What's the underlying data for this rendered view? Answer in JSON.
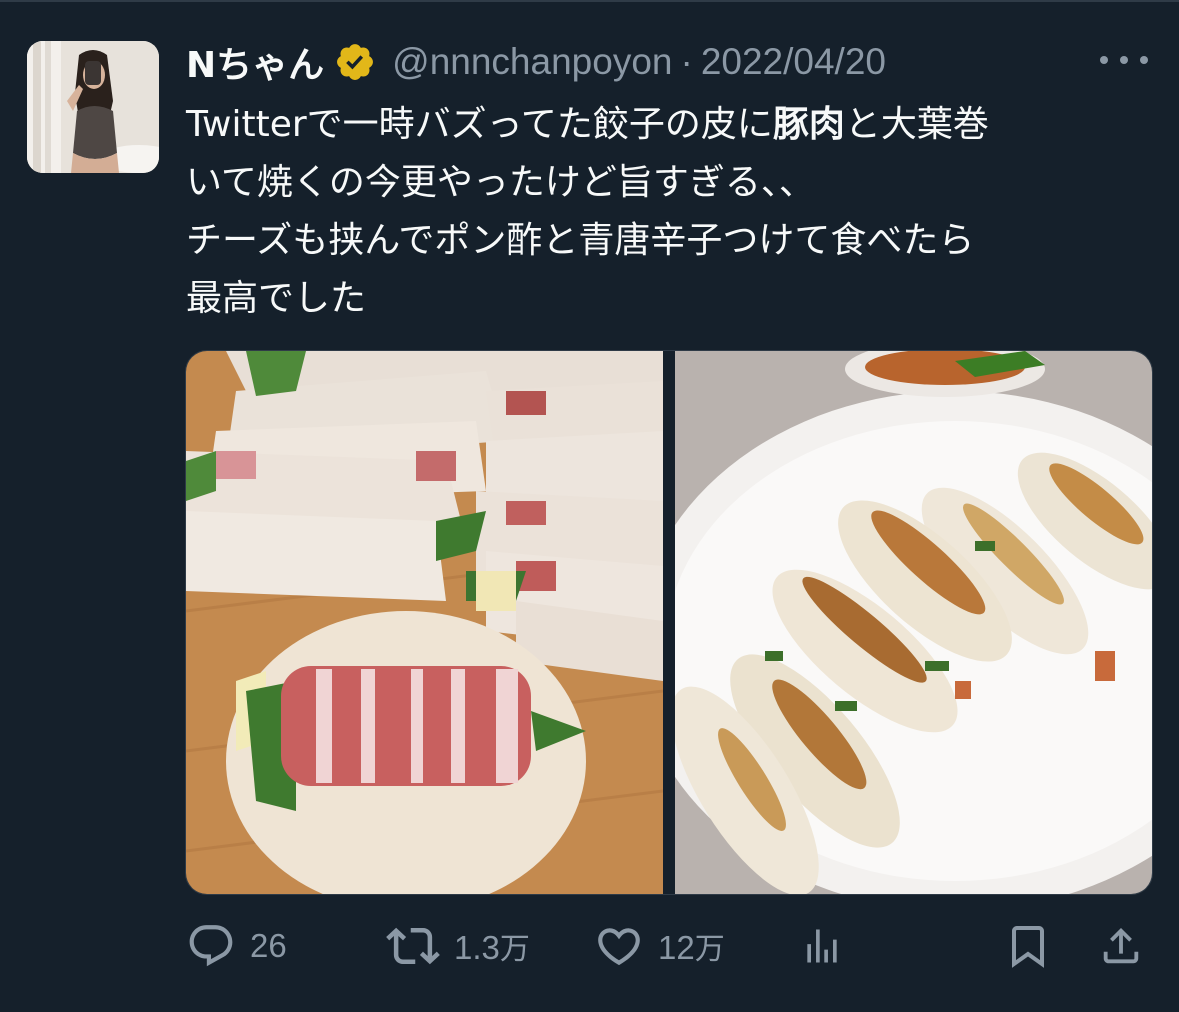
{
  "tweet": {
    "author": {
      "display_name": "Nちゃん",
      "handle": "@nnnchanpoyon",
      "verified": true,
      "avatar": "avatar-photo"
    },
    "separator": "·",
    "date": "2022/04/20",
    "text": {
      "line1_before": "Twitterで一時バズってた餃子の皮に",
      "line1_bold": "豚肉",
      "line1_after": "と大葉巻",
      "line2": "いて焼くの今更やったけど旨すぎる、、",
      "line3": "チーズも挟んでポン酢と青唐辛子つけて食べたら",
      "line4": "最高でした"
    },
    "media": [
      {
        "icon": "photo-rolled-gyoza-wrappers"
      },
      {
        "icon": "photo-fried-gyoza-plate"
      }
    ],
    "actions": {
      "replies": {
        "icon": "reply-icon",
        "count": "26"
      },
      "retweets": {
        "icon": "retweet-icon",
        "count_number": "1.3",
        "count_unit": "万"
      },
      "likes": {
        "icon": "heart-icon",
        "count_number": "12",
        "count_unit": "万"
      },
      "views": {
        "icon": "analytics-icon"
      },
      "bookmark": {
        "icon": "bookmark-icon"
      },
      "share": {
        "icon": "share-icon"
      }
    }
  },
  "colors": {
    "background": "#15202b",
    "text_primary": "#f7f9f9",
    "text_secondary": "#8b98a5",
    "verified_gold": "#e2b719"
  }
}
